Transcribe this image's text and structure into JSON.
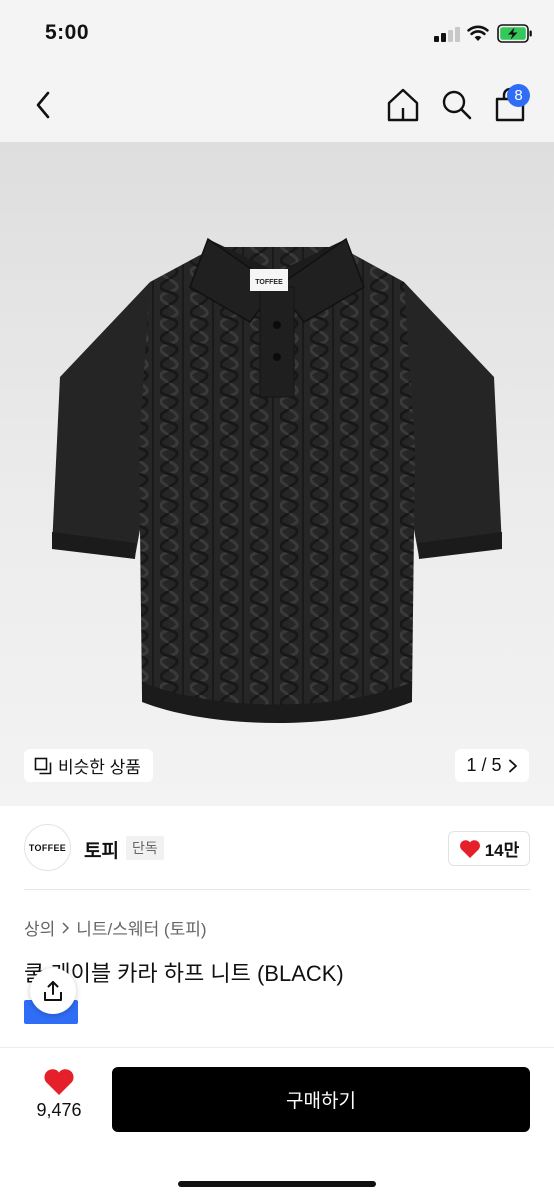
{
  "status_bar": {
    "time": "5:00"
  },
  "nav": {
    "back_icon": "chevron-left-icon",
    "home_icon": "home-icon",
    "search_icon": "search-icon",
    "cart_icon": "shopping-bag-icon",
    "cart_count": "8"
  },
  "hero": {
    "image": "black cable-knit short sleeve polo shirt",
    "label_text": "TOFFEE",
    "similar_label": "비슷한 상품",
    "page_indicator": "1 / 5"
  },
  "brand": {
    "logo_text": "TOFFEE",
    "name": "토피",
    "tag": "단독",
    "like_count": "14만"
  },
  "product": {
    "breadcrumb": [
      "상의",
      "니트/스웨터 (토피)"
    ],
    "title": "쿨 케이블 카라 하프 니트 (BLACK)"
  },
  "bottom_bar": {
    "like_count": "9,476",
    "buy_label": "구매하기"
  },
  "colors": {
    "accent_blue": "#2f6df6",
    "heart_red": "#e5202a",
    "button_black": "#000000"
  }
}
